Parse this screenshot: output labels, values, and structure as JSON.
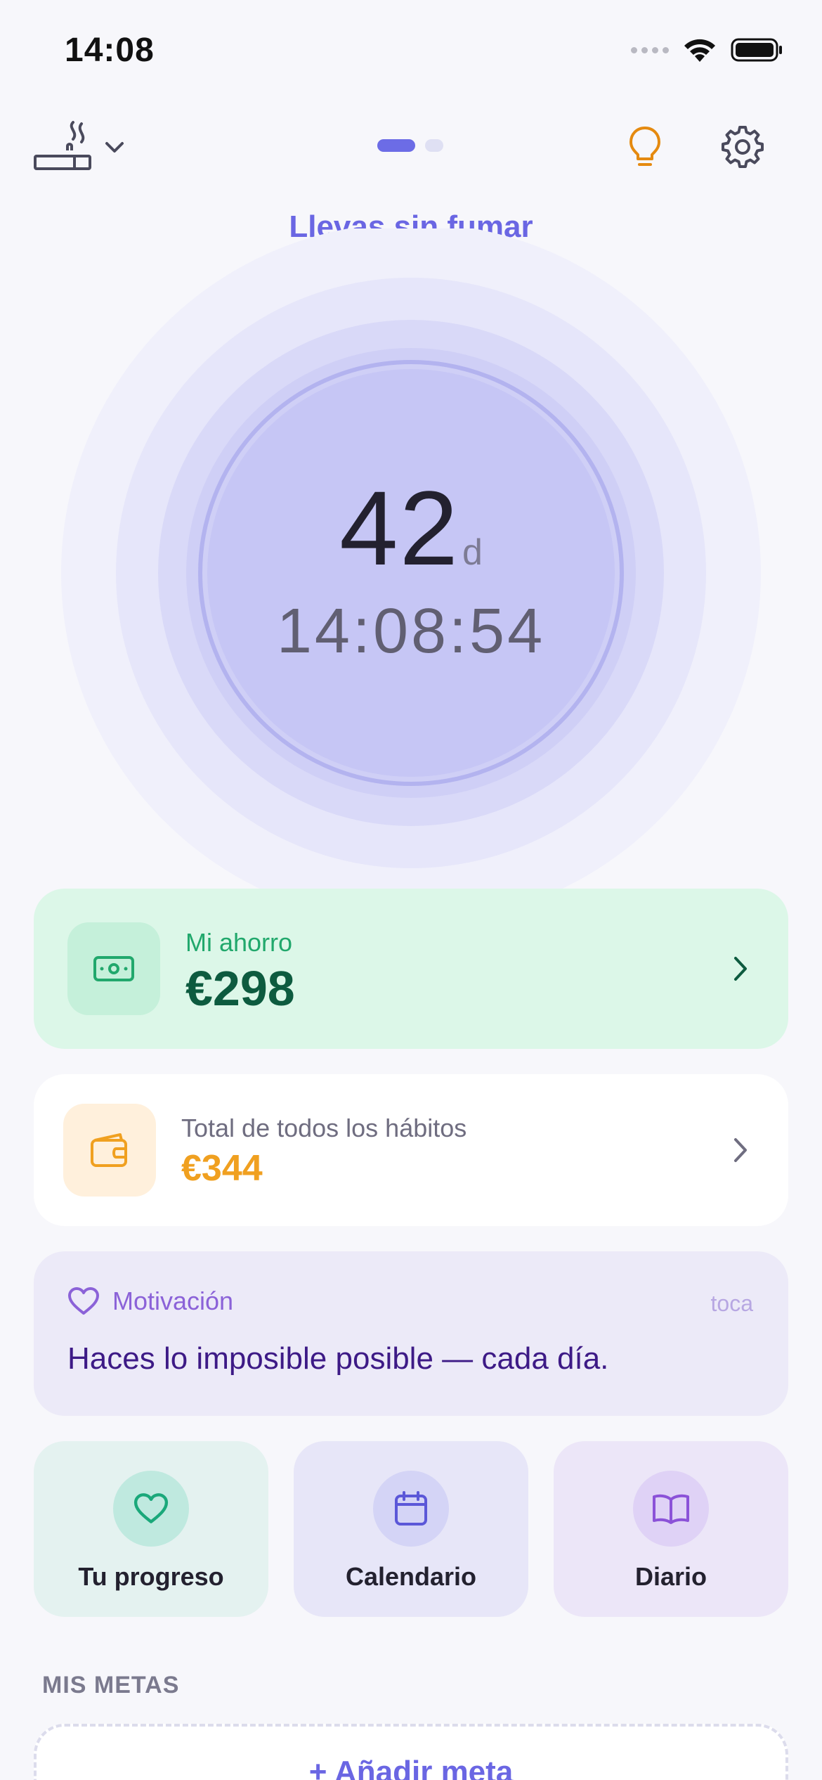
{
  "status_bar": {
    "time": "14:08"
  },
  "nav": {
    "active_page": 1,
    "page_count": 2
  },
  "hero": {
    "label": "Llevas sin fumar",
    "days": "42",
    "days_unit": "d",
    "clock": "14:08:54"
  },
  "savings": {
    "title": "Mi ahorro",
    "value": "€298"
  },
  "total": {
    "title": "Total de todos los hábitos",
    "value": "€344"
  },
  "motivation": {
    "title": "Motivación",
    "hint": "toca",
    "quote": "Haces lo imposible posible — cada día."
  },
  "tiles": [
    {
      "label": "Tu progreso",
      "icon": "heart-icon"
    },
    {
      "label": "Calendario",
      "icon": "calendar-icon"
    },
    {
      "label": "Diario",
      "icon": "book-icon"
    }
  ],
  "goals": {
    "section_title": "MIS METAS",
    "add_label": "+ Añadir meta"
  },
  "colors": {
    "accent": "#6a66e3",
    "savings_green": "#0d5b3f",
    "total_orange": "#f0a020",
    "motivation_purple": "#3d1a86"
  }
}
